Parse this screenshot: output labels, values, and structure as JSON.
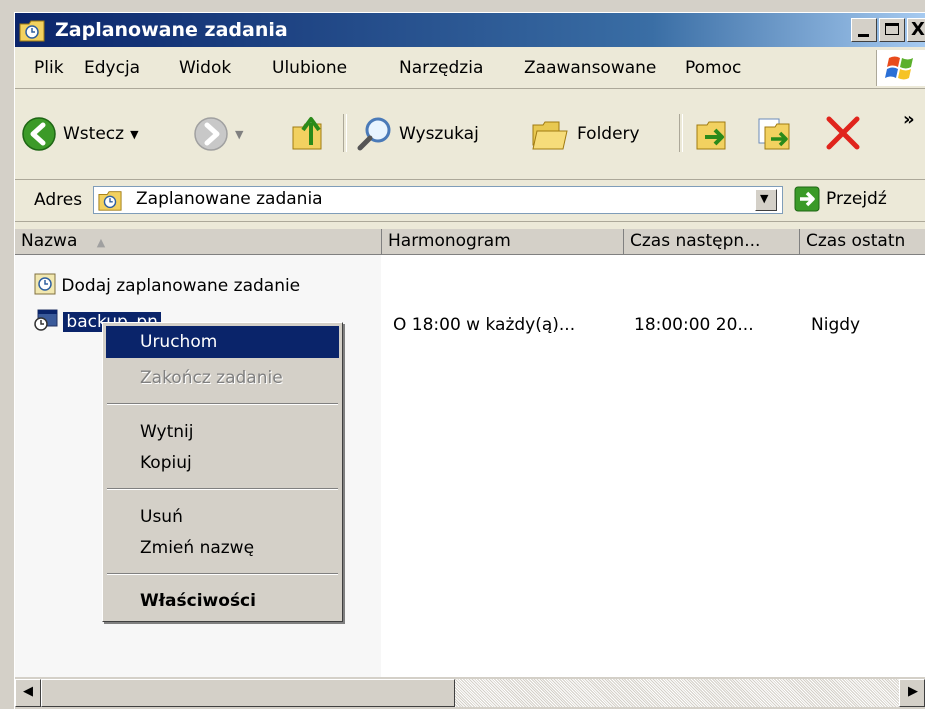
{
  "window": {
    "title": "Zaplanowane zadania",
    "controls": {
      "minimize": "_",
      "maximize": "□",
      "close": "X"
    }
  },
  "menubar": [
    "Plik",
    "Edycja",
    "Widok",
    "Ulubione",
    "Narzędzia",
    "Zaawansowane",
    "Pomoc"
  ],
  "toolbar": {
    "back_label": "Wstecz",
    "search_label": "Wyszukaj",
    "folders_label": "Foldery",
    "more": "»"
  },
  "address": {
    "label": "Adres",
    "value": "Zaplanowane zadania",
    "go_label": "Przejdź"
  },
  "columns": [
    "Nazwa",
    "Harmonogram",
    "Czas następn...",
    "Czas ostatn"
  ],
  "rows": [
    {
      "name": "Dodaj zaplanowane zadanie",
      "schedule": "",
      "next_run": "",
      "last_run": ""
    },
    {
      "name": "backup_pn",
      "schedule": "O 18:00 w każdy(ą)...",
      "next_run": "18:00:00  20...",
      "last_run": "Nigdy"
    }
  ],
  "context_menu": {
    "run": "Uruchom",
    "end_task": "Zakończ zadanie",
    "cut": "Wytnij",
    "copy": "Kopiuj",
    "delete": "Usuń",
    "rename": "Zmień nazwę",
    "properties": "Właściwości"
  },
  "colors": {
    "title_bar": "#0a246a",
    "selection": "#0a246a",
    "face": "#d4d0c8",
    "disabled_text": "#808080"
  }
}
